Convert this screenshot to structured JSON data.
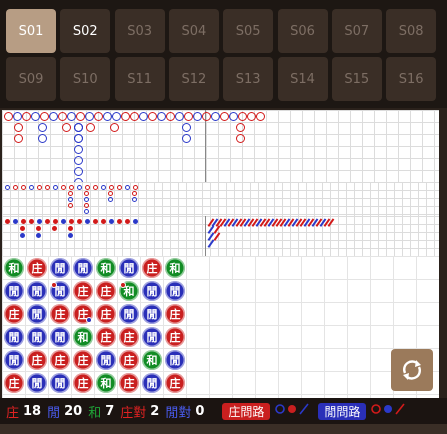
{
  "tabs": [
    {
      "label": "S01",
      "selected": true
    },
    {
      "label": "S02",
      "bright": true
    },
    {
      "label": "S03"
    },
    {
      "label": "S04"
    },
    {
      "label": "S05"
    },
    {
      "label": "S06"
    },
    {
      "label": "S07"
    },
    {
      "label": "S08"
    },
    {
      "label": "S09"
    },
    {
      "label": "S10"
    },
    {
      "label": "S11"
    },
    {
      "label": "S12"
    },
    {
      "label": "S13"
    },
    {
      "label": "S14"
    },
    {
      "label": "S15"
    },
    {
      "label": "S16"
    }
  ],
  "bead_glyphs": {
    "B": "庄",
    "P": "閒",
    "T": "和"
  },
  "bead_plate": [
    [
      "T",
      "P",
      "B",
      "P",
      "P",
      "B"
    ],
    [
      "B",
      "P",
      "P",
      "P",
      "B",
      "P"
    ],
    [
      "P",
      "P",
      "B",
      "P",
      "B",
      "P"
    ],
    [
      "P",
      "B",
      "B",
      "T",
      "B",
      "B"
    ],
    [
      "T",
      "B",
      "B",
      "B",
      "P",
      "T"
    ],
    [
      "P",
      "T",
      "P",
      "B",
      "B",
      "B"
    ],
    [
      "B",
      "P",
      "P",
      "P",
      "T",
      "P"
    ],
    [
      "T",
      "P",
      "B",
      "B",
      "P",
      "B"
    ]
  ],
  "stats": {
    "banker_label": "庄",
    "banker_count": "18",
    "player_label": "閒",
    "player_count": "20",
    "tie_label": "和",
    "tie_count": "7",
    "banker_pair_label": "庄對",
    "banker_pair_count": "2",
    "player_pair_label": "閒對",
    "player_pair_count": "0"
  },
  "ask": {
    "banker_label": "庄問路",
    "player_label": "閒問路"
  },
  "colors": {
    "banker": "#c91f1f",
    "player": "#2a2fb8",
    "tie": "#118c24",
    "tab_selected": "#b79d84"
  },
  "icons": {
    "switch": "refresh-swap-icon"
  }
}
